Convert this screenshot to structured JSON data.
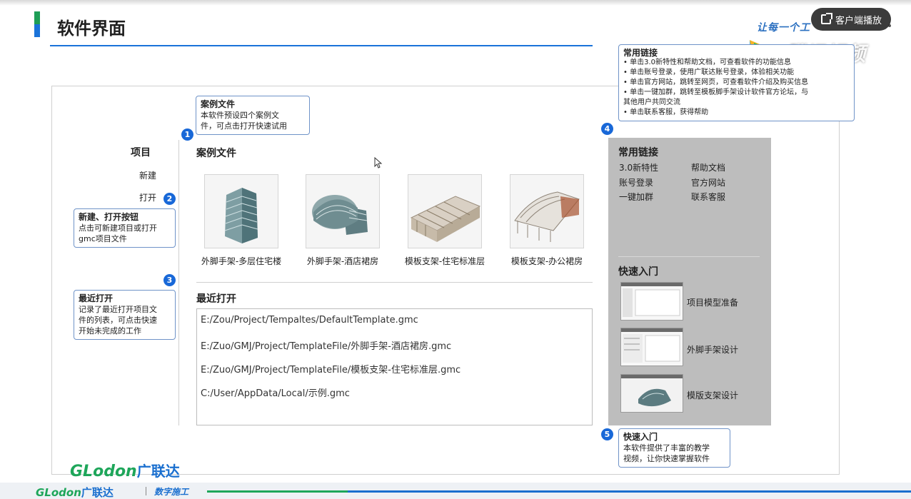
{
  "header": {
    "title": "软件界面",
    "slogan": "让每一个工"
  },
  "player": {
    "client_button": "客户端播放",
    "watermark": "腾讯视频"
  },
  "nav": {
    "heading": "项目",
    "new": "新建",
    "open": "打开"
  },
  "samples": {
    "title": "案例文件",
    "items": [
      {
        "label": "外脚手架-多层住宅楼"
      },
      {
        "label": "外脚手架-酒店裙房"
      },
      {
        "label": "模板支架-住宅标准层"
      },
      {
        "label": "模板支架-办公裙房"
      }
    ]
  },
  "recent": {
    "title": "最近打开",
    "items": [
      "E:/Zou/Project/Tempaltes/DefaultTemplate.gmc",
      "E:/Zuo/GMJ/Project/TemplateFile/外脚手架-酒店裙房.gmc",
      "E:/Zuo/GMJ/Project/TemplateFile/模板支架-住宅标准层.gmc",
      "C:/User/AppData/Local/示例.gmc"
    ]
  },
  "links": {
    "title": "常用链接",
    "items": [
      "3.0新特性",
      "帮助文档",
      "账号登录",
      "官方网站",
      "一键加群",
      "联系客服"
    ]
  },
  "quickstart": {
    "title": "快速入门",
    "items": [
      "项目模型准备",
      "外脚手架设计",
      "模版支架设计"
    ]
  },
  "callouts": {
    "c1": {
      "num": "1",
      "title": "案例文件",
      "lines": [
        "本软件预设四个案例文",
        "件，可点击打开快速试用"
      ]
    },
    "c2": {
      "num": "2",
      "title": "新建、打开按钮",
      "lines": [
        "点击可新建项目或打开",
        "gmc项目文件"
      ]
    },
    "c3": {
      "num": "3",
      "title": "最近打开",
      "lines": [
        "记录了最近打开项目文",
        "件的列表，可点击快速",
        "开始未完成的工作"
      ]
    },
    "c4": {
      "num": "4",
      "title": "常用链接",
      "lines": [
        "• 单击3.0新特性和帮助文档，可查看软件的功能信息",
        "• 单击账号登录，使用广联达账号登录，体验相关功能",
        "• 单击官方网站，跳转至网页，可查看软件介绍及购买信息",
        "• 单击一键加群，跳转至模板脚手架设计软件官方论坛，与",
        "其他用户共同交流",
        "• 单击联系客服，获得帮助"
      ]
    },
    "c5": {
      "num": "5",
      "title": "快速入门",
      "lines": [
        "本软件提供了丰富的教学",
        "视频，让你快速掌握软件"
      ]
    }
  },
  "footer": {
    "brand": "GLodon",
    "brand_cn": "广联达",
    "sub": "数字施工"
  }
}
